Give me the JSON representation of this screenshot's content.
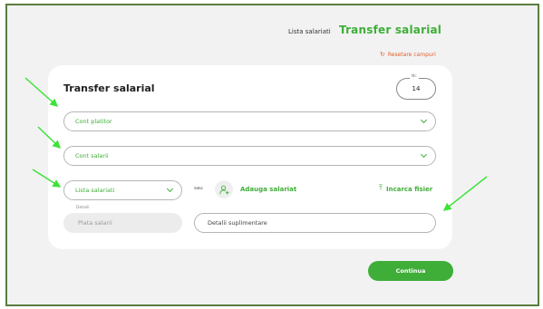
{
  "header": {
    "tab_inactive": "Lista salariati",
    "tab_active": "Transfer salarial"
  },
  "reset": {
    "icon": "refresh-icon",
    "label": "Resetare campuri"
  },
  "form": {
    "title": "Transfer salarial",
    "nr_label": "Nr.",
    "nr_value": "14",
    "cont_platitor": "Cont platitor",
    "cont_salarii": "Cont salarii",
    "lista_salariati": "Lista salariati",
    "sau": "sau",
    "add_salariat": "Adauga salariat",
    "upload": "Incarca fisier",
    "detalii_label": "Detalii",
    "detalii_value": "Plata salarii",
    "detalii_suplimentare_placeholder": "Detalii suplimentare",
    "continue": "Continua"
  },
  "colors": {
    "accent": "#3fae38",
    "reset": "#e0622a",
    "arrow": "#3ee23a"
  }
}
